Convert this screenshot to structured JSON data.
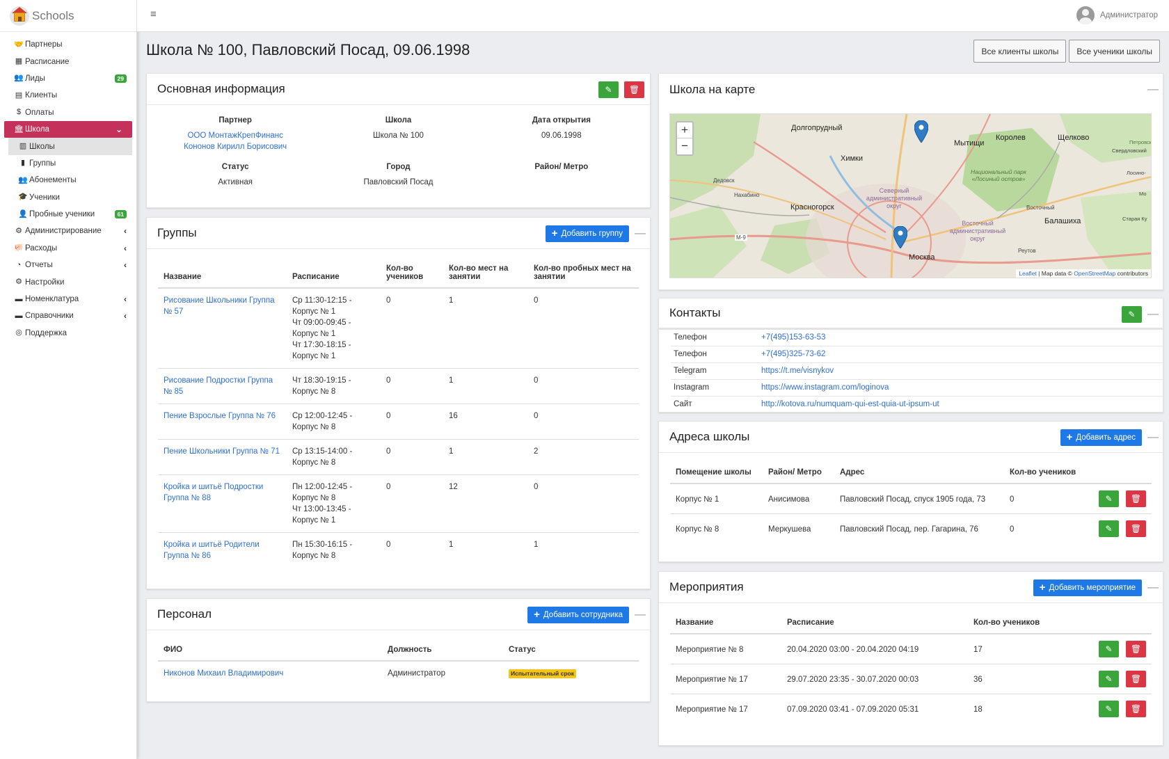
{
  "app": {
    "name": "Schools"
  },
  "sidebar": {
    "items": [
      {
        "label": "Партнеры",
        "icon": "handshake-icon",
        "glyph": "🤝"
      },
      {
        "label": "Расписание",
        "icon": "calendar-icon",
        "glyph": "▦"
      },
      {
        "label": "Лиды",
        "icon": "users-icon",
        "glyph": "👥",
        "badge": "29"
      },
      {
        "label": "Клиенты",
        "icon": "id-card-icon",
        "glyph": "▤"
      },
      {
        "label": "Оплаты",
        "icon": "money-icon",
        "glyph": "$"
      },
      {
        "label": "Школа",
        "icon": "university-icon",
        "glyph": "🏛",
        "active": true,
        "chevron": "⌄"
      },
      {
        "label": "Школы",
        "icon": "building-icon",
        "glyph": "▥",
        "sub": true,
        "selected": true
      },
      {
        "label": "Группы",
        "icon": "books-icon",
        "glyph": "▮",
        "sub": true
      },
      {
        "label": "Абонементы",
        "icon": "users-icon",
        "glyph": "👥",
        "sub": true
      },
      {
        "label": "Ученики",
        "icon": "student-icon",
        "glyph": "🎓",
        "sub": true
      },
      {
        "label": "Пробные ученики",
        "icon": "user-plus-icon",
        "glyph": "👤",
        "sub": true,
        "badge": "61"
      },
      {
        "label": "Администрирование",
        "icon": "cogs-icon",
        "glyph": "⚙",
        "chevron": "‹"
      },
      {
        "label": "Расходы",
        "icon": "piggy-bank-icon",
        "glyph": "🐖",
        "chevron": "‹"
      },
      {
        "label": "Отчеты",
        "icon": "pie-chart-icon",
        "glyph": "◔",
        "chevron": "‹"
      },
      {
        "label": "Настройки",
        "icon": "gears-icon",
        "glyph": "⚙"
      },
      {
        "label": "Номенклатура",
        "icon": "book-icon",
        "glyph": "▬",
        "chevron": "‹"
      },
      {
        "label": "Справочники",
        "icon": "book-icon",
        "glyph": "▬",
        "chevron": "‹"
      },
      {
        "label": "Поддержка",
        "icon": "lifebuoy-icon",
        "glyph": "◎"
      }
    ]
  },
  "topbar": {
    "user": "Администратор"
  },
  "page": {
    "title": "Школа № 100, Павловский Посад, 09.06.1998",
    "buttons": [
      "Все клиенты школы",
      "Все ученики школы"
    ]
  },
  "main_info": {
    "title": "Основная информация",
    "partner_label": "Партнер",
    "partner_links": [
      "ООО МонтажКрепФинанс",
      "Кононов Кирилл Борисович"
    ],
    "school_label": "Школа",
    "school_value": "Школа № 100",
    "opened_label": "Дата открытия",
    "opened_value": "09.06.1998",
    "status_label": "Статус",
    "status_value": "Активная",
    "city_label": "Город",
    "city_value": "Павловский Посад",
    "district_label": "Район/ Метро",
    "district_value": ""
  },
  "groups": {
    "title": "Группы",
    "add_label": "Добавить группу",
    "columns": [
      "Название",
      "Расписание",
      "Кол-во учеников",
      "Кол-во мест на занятии",
      "Кол-во пробных мест на занятии"
    ],
    "rows": [
      {
        "name": "Рисование Школьники Группа № 57",
        "schedule": [
          "Ср 11:30-12:15 -",
          "Корпус № 1",
          "Чт 09:00-09:45 -",
          "Корпус № 1",
          "Чт 17:30-18:15 -",
          "Корпус № 1"
        ],
        "students": "0",
        "places": "1",
        "trial": "0"
      },
      {
        "name": "Рисование Подростки Группа № 85",
        "schedule": [
          "Чт 18:30-19:15 -",
          "Корпус № 8"
        ],
        "students": "0",
        "places": "1",
        "trial": "0"
      },
      {
        "name": "Пение Взрослые Группа № 76",
        "schedule": [
          "Ср 12:00-12:45 -",
          "Корпус № 8"
        ],
        "students": "0",
        "places": "16",
        "trial": "0"
      },
      {
        "name": "Пение Школьники Группа № 71",
        "schedule": [
          "Ср 13:15-14:00 -",
          "Корпус № 8"
        ],
        "students": "0",
        "places": "1",
        "trial": "2"
      },
      {
        "name": "Кройка и шитьё Подростки Группа № 88",
        "schedule": [
          "Пн 12:00-12:45 -",
          "Корпус № 8",
          "Чт 13:00-13:45 -",
          "Корпус № 1"
        ],
        "students": "0",
        "places": "12",
        "trial": "0"
      },
      {
        "name": "Кройка и шитьё Родители Группа № 86",
        "schedule": [
          "Пн 15:30-16:15 -",
          "Корпус № 8"
        ],
        "students": "0",
        "places": "1",
        "trial": "1"
      }
    ]
  },
  "staff": {
    "title": "Персонал",
    "add_label": "Добавить сотрудника",
    "columns": [
      "ФИО",
      "Должность",
      "Статус"
    ],
    "rows": [
      {
        "name": "Никонов Михаил Владимирович",
        "position": "Администратор",
        "status": "Испытательный срок"
      }
    ]
  },
  "map": {
    "title": "Школа на карте",
    "zoom_in": "+",
    "zoom_out": "−",
    "attribution_leaflet": "Leaflet",
    "attribution_text": "| Map data ©",
    "attribution_osm": "OpenStreetMap",
    "attribution_tail": "contributors",
    "labels": [
      "Долгопрудный",
      "Мытищи",
      "Королев",
      "Щелково",
      "Химки",
      "Дедовск",
      "Нахабино",
      "Красногорск",
      "Северный административный округ",
      "Национальный парк «Лосиный остров»",
      "Восточный",
      "Балашиха",
      "Восточный административный округ",
      "Реутов",
      "Москва",
      "М-9",
      "Свердловский",
      "Лосино-",
      "Старая Ку",
      "Петровск",
      "Мо"
    ]
  },
  "contacts": {
    "title": "Контакты",
    "rows": [
      {
        "label": "Телефон",
        "value": "+7(495)153-63-53"
      },
      {
        "label": "Телефон",
        "value": "+7(495)325-73-62"
      },
      {
        "label": "Telegram",
        "value": "https://t.me/visnykov"
      },
      {
        "label": "Instagram",
        "value": "https://www.instagram.com/loginova"
      },
      {
        "label": "Сайт",
        "value": "http://kotova.ru/numquam-qui-est-quia-ut-ipsum-ut"
      }
    ]
  },
  "addresses": {
    "title": "Адреса школы",
    "add_label": "Добавить адрес",
    "columns": [
      "Помещение школы",
      "Район/ Метро",
      "Адрес",
      "Кол-во учеников"
    ],
    "rows": [
      {
        "room": "Корпус № 1",
        "metro": "Анисимова",
        "address": "Павловский Посад, спуск 1905 года, 73",
        "students": "0"
      },
      {
        "room": "Корпус № 8",
        "metro": "Меркушева",
        "address": "Павловский Посад, пер. Гагарина, 76",
        "students": "0"
      }
    ]
  },
  "events": {
    "title": "Мероприятия",
    "add_label": "Добавить мероприятие",
    "columns": [
      "Название",
      "Расписание",
      "Кол-во учеников"
    ],
    "rows": [
      {
        "name": "Мероприятие № 8",
        "schedule": "20.04.2020 03:00 - 20.04.2020 04:19",
        "students": "17"
      },
      {
        "name": "Мероприятие № 17",
        "schedule": "29.07.2020 23:35 - 30.07.2020 00:03",
        "students": "36"
      },
      {
        "name": "Мероприятие № 17",
        "schedule": "07.09.2020 03:41 - 07.09.2020 05:31",
        "students": "18"
      }
    ]
  },
  "colors": {
    "accent": "#c4315b",
    "primary": "#1e78e6",
    "success": "#3aa53a",
    "danger": "#dc3544",
    "link": "#2f6fd4"
  }
}
